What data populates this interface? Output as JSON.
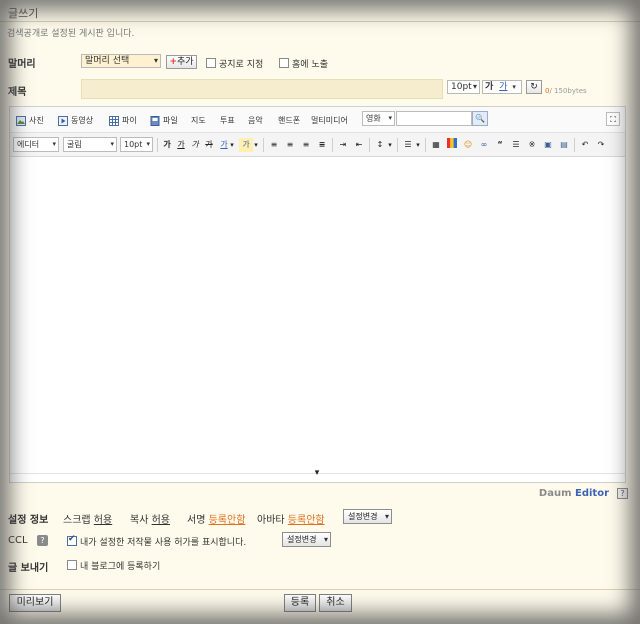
{
  "header": {
    "title": "글쓰기",
    "notice": "검색공개로 설정된 게시판 입니다."
  },
  "form": {
    "prefix_label": "말머리",
    "prefix_select": "말머리 선택",
    "add_button": "추가",
    "notice_checkbox": "공지로 지정",
    "home_checkbox": "홈에 노출",
    "subject_label": "제목",
    "subject_value": "",
    "font_size": "10pt",
    "bold_glyph": "가",
    "underline_glyph": "가",
    "byte_count": "0",
    "byte_limit": "/ 150bytes"
  },
  "editor": {
    "insert_toolbar": [
      "사진",
      "동영상",
      "파이",
      "파일",
      "지도",
      "투표",
      "음악",
      "핸드폰",
      "멀티미디어"
    ],
    "search_scope": "영화",
    "search_value": "",
    "search_glyph": "🔍",
    "format_toolbar": {
      "mode": "에디터",
      "font": "굴림",
      "size": "10pt"
    },
    "format_glyphs": [
      "가",
      "가",
      "가",
      "가",
      "가",
      "가"
    ],
    "content": "",
    "collapse_glyph": "▾",
    "fullscreen_glyph": "⛶"
  },
  "brand": {
    "daum": "Daum",
    "editor": "Editor",
    "help": "?"
  },
  "settings": {
    "info_label": "설정 정보",
    "scrap_label": "스크랩",
    "scrap_value": "허용",
    "copy_label": "복사",
    "copy_value": "허용",
    "sign_label": "서명",
    "sign_value": "등록안함",
    "avatar_label": "아바타",
    "avatar_value": "등록안함",
    "change_button": "설정변경",
    "ccl_label": "CCL",
    "ccl_help": "?",
    "ccl_checkbox": "내가 설정한 저작물 사용 허가를 표시합니다.",
    "ccl_checked": true,
    "ccl_change_button": "설정변경",
    "send_label": "글 보내기",
    "blog_checkbox": "내 블로그에 등록하기",
    "blog_checked": false
  },
  "footer": {
    "preview": "미리보기",
    "submit": "등록",
    "cancel": "취소"
  },
  "colors": {
    "background": "#fffbec",
    "link_orange": "#e0701c",
    "brand_blue": "#3b63b5"
  }
}
